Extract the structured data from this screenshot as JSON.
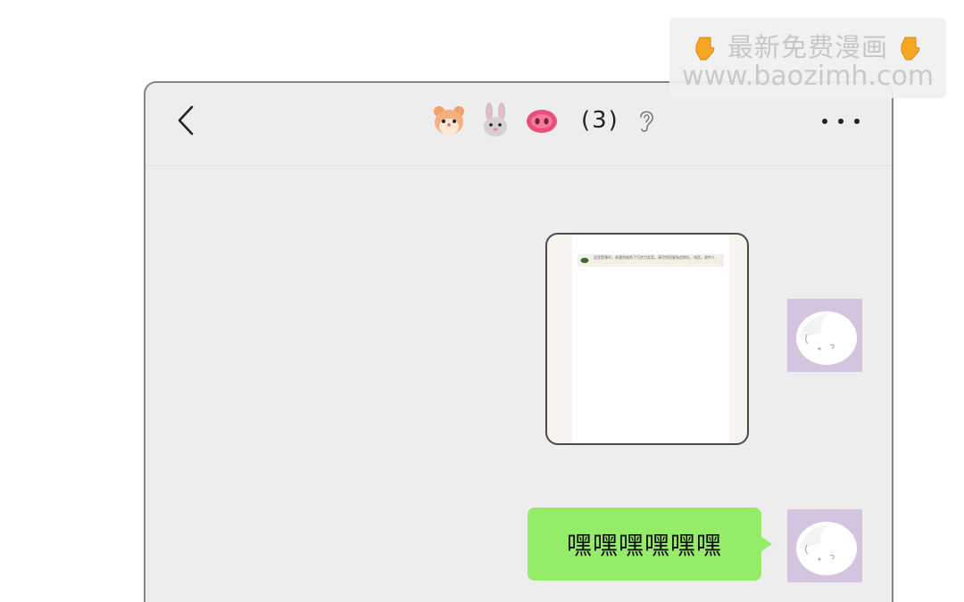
{
  "watermark": {
    "line1": "最新免费漫画",
    "line2": "www.baozimh.com"
  },
  "header": {
    "member_count": "(3)",
    "emojis": [
      "hamster-face-icon",
      "rabbit-face-icon",
      "pig-nose-icon"
    ],
    "ear_icon": "ear-icon",
    "back_icon": "chevron-left-icon",
    "more_icon": "more-dots-icon"
  },
  "messages": [
    {
      "type": "image",
      "sender": "self",
      "image_text": "这里是薄木。恭喜你抽到了巧克力奖奖。请尽快回复私信地址，电话，收件人"
    },
    {
      "type": "text",
      "sender": "self",
      "text": "嘿嘿嘿嘿嘿嘿"
    }
  ],
  "colors": {
    "chat_background": "#ededed",
    "bubble_green": "#95ec69",
    "avatar_background": "#d3c4df",
    "frame_border": "#8d7f84"
  }
}
